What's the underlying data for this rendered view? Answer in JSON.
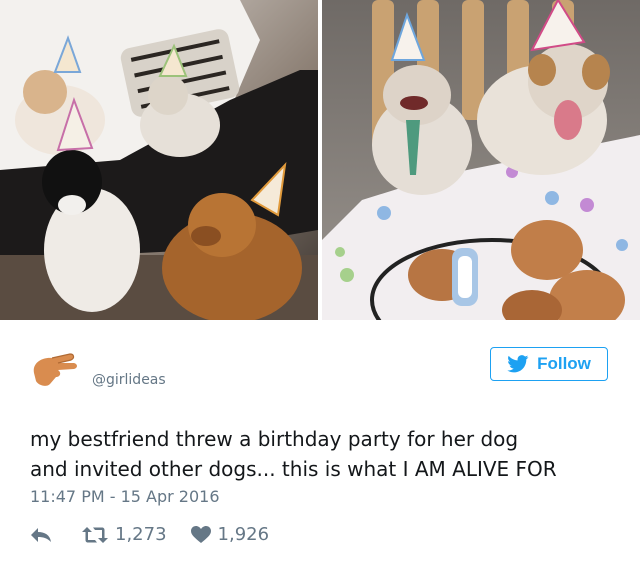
{
  "photos": {
    "left": {
      "alt": ""
    },
    "right": {
      "alt": ""
    }
  },
  "tweet": {
    "handle": "@girlideas",
    "follow_label": "Follow",
    "text_line1": "my bestfriend threw a birthday party for her dog",
    "text_line2": "and invited other dogs... this is what I AM ALIVE FOR",
    "timestamp": "11:47 PM - 15 Apr 2016",
    "retweets": "1,273",
    "likes": "1,926"
  },
  "icons": {
    "avatar": "pinching-hand-avatar",
    "follow": "twitter-bird-icon",
    "reply": "reply-arrow-icon",
    "retweet": "retweet-icon",
    "like": "heart-icon"
  },
  "colors": {
    "accent": "#1da1f2",
    "muted": "#657786",
    "text": "#14171a"
  }
}
